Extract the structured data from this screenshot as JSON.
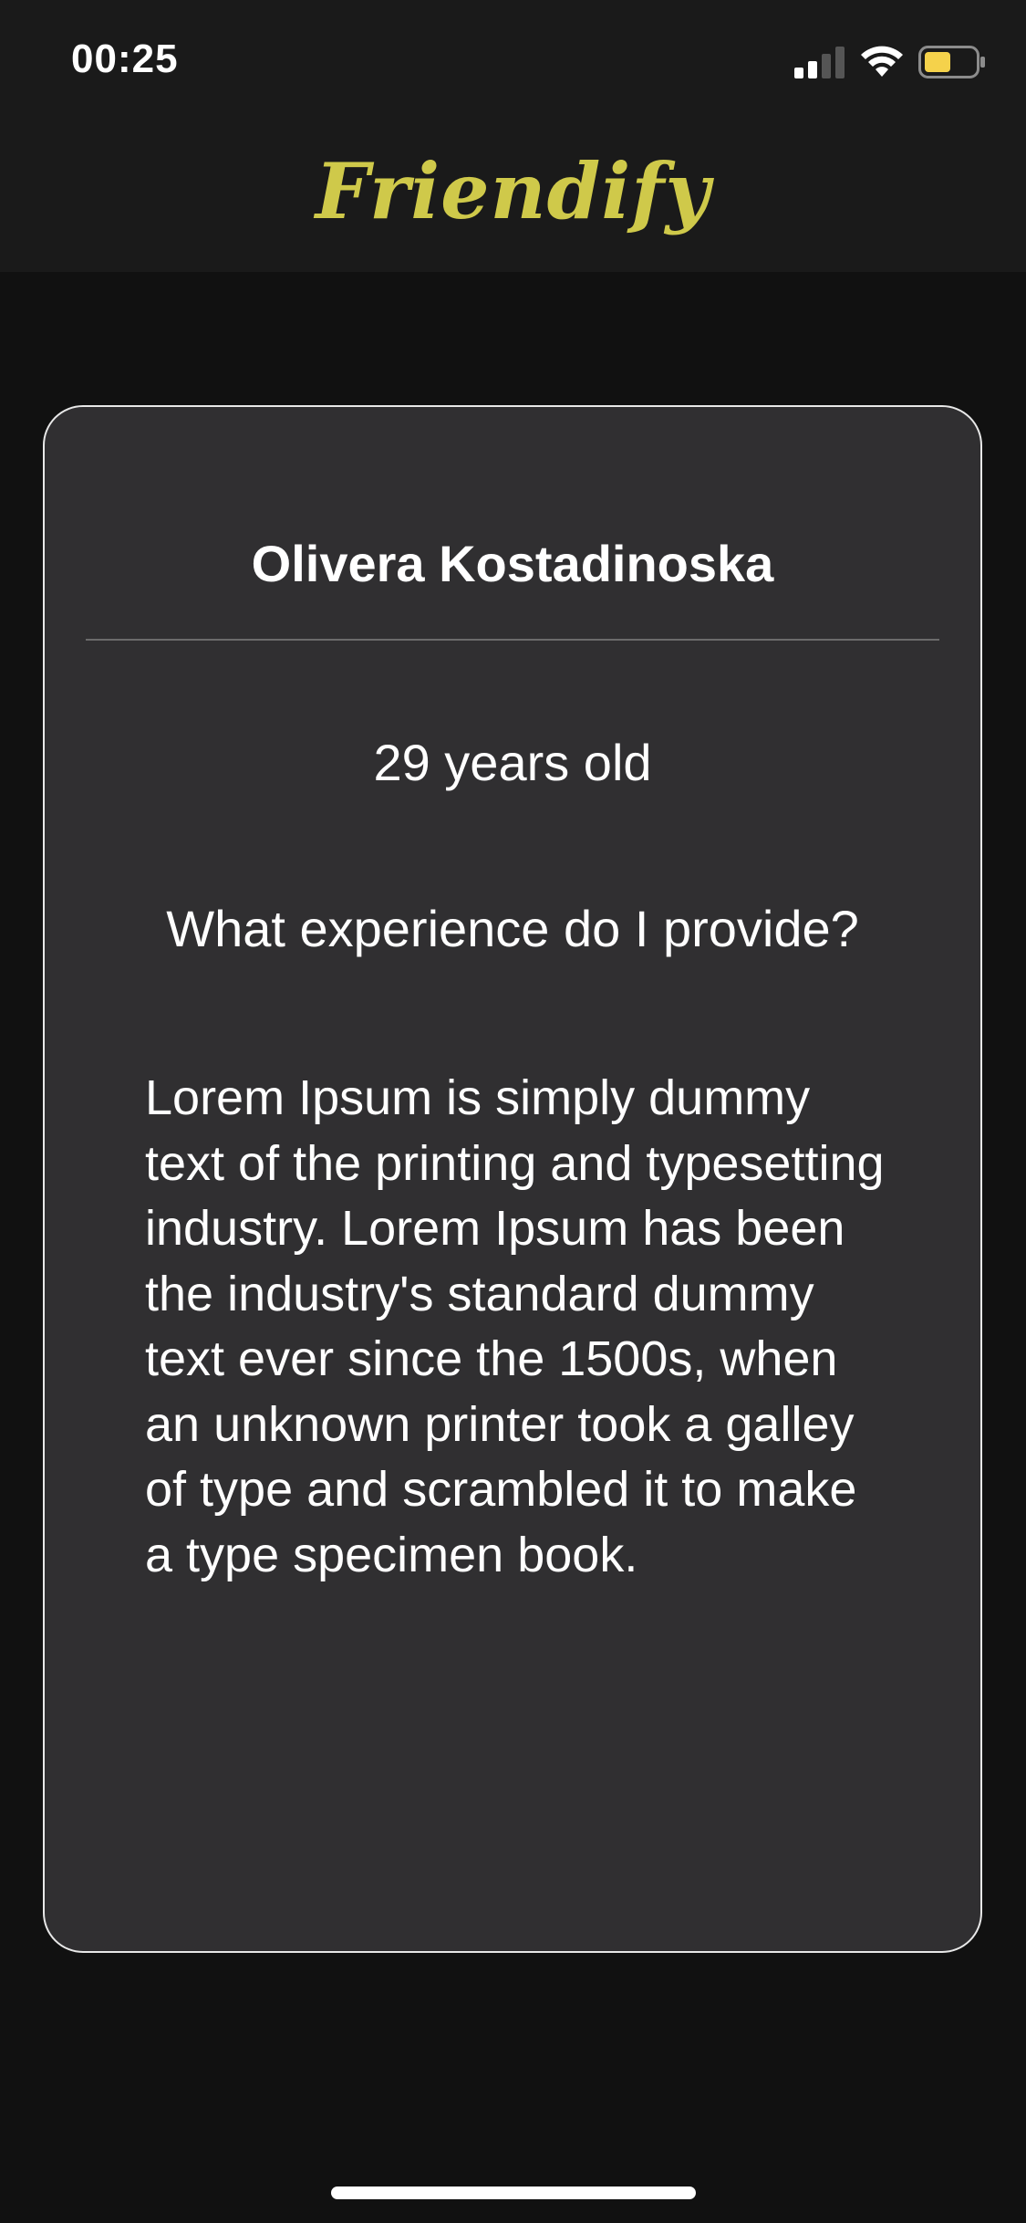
{
  "status_bar": {
    "time": "00:25",
    "icons": [
      "signal-icon",
      "wifi-icon",
      "battery-icon"
    ],
    "battery_color": "#f5d24b"
  },
  "header": {
    "logo_text": "Friendify",
    "logo_color": "#cfc94a"
  },
  "profile": {
    "name": "Olivera Kostadinoska",
    "age": "29 years old",
    "question": "What experience do I provide?",
    "description": "Lorem Ipsum is simply dummy text of the printing and typesetting industry. Lorem Ipsum has been the industry's standard dummy text ever since the 1500s, when an unknown printer took a galley of type and scrambled it to make a type specimen book."
  },
  "colors": {
    "background": "#111111",
    "header_background": "#1a1a1a",
    "card_background": "#302f31",
    "card_border": "#e8e8e8"
  }
}
